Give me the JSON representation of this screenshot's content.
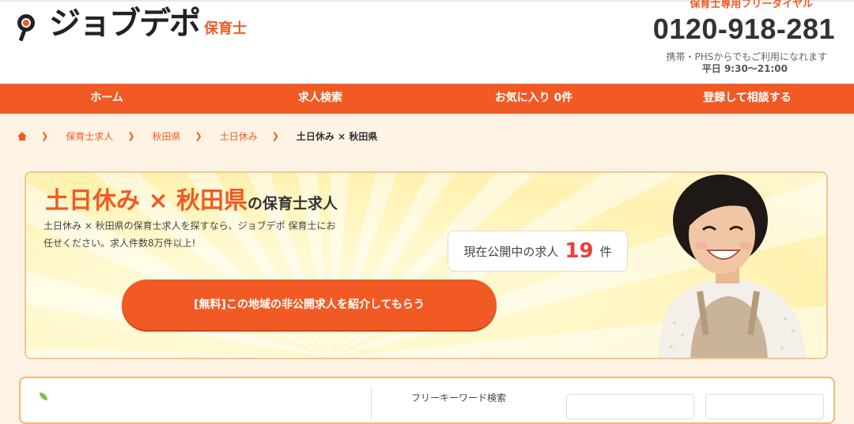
{
  "header": {
    "logo_text": "ジョブデポ",
    "logo_sub": "保育士",
    "hotline_label": "保育士専用フリーダイヤル",
    "phone": "0120-918-281",
    "phone_note": "携帯・PHSからでもご利用になれます",
    "phone_hours": "平日 9:30〜21:00"
  },
  "nav": {
    "items": [
      {
        "label": "ホーム"
      },
      {
        "label": "求人検索"
      },
      {
        "label": "お気に入り 0件"
      },
      {
        "label": "登録して相談する"
      }
    ]
  },
  "breadcrumb": {
    "items": [
      "保育士求人",
      "秋田県",
      "土日休み"
    ],
    "current": "土日休み × 秋田県"
  },
  "hero": {
    "title_main": "土日休み × 秋田県",
    "title_suffix": "の保育士求人",
    "desc_line1": "土日休み × 秋田県の保育士求人を探すなら、ジョブデポ 保育士にお",
    "desc_line2": "任せください。求人件数8万件以上!",
    "count_label": "現在公開中の求人",
    "count_value": "19",
    "count_unit": "件",
    "cta_label": "[無料]この地域の非公開求人を紹介してもらう"
  },
  "panel": {
    "label": "フリーキーワード検索"
  },
  "colors": {
    "accent": "#f15a24",
    "count": "#e8413a",
    "hero_bg": "#fff2b0"
  }
}
